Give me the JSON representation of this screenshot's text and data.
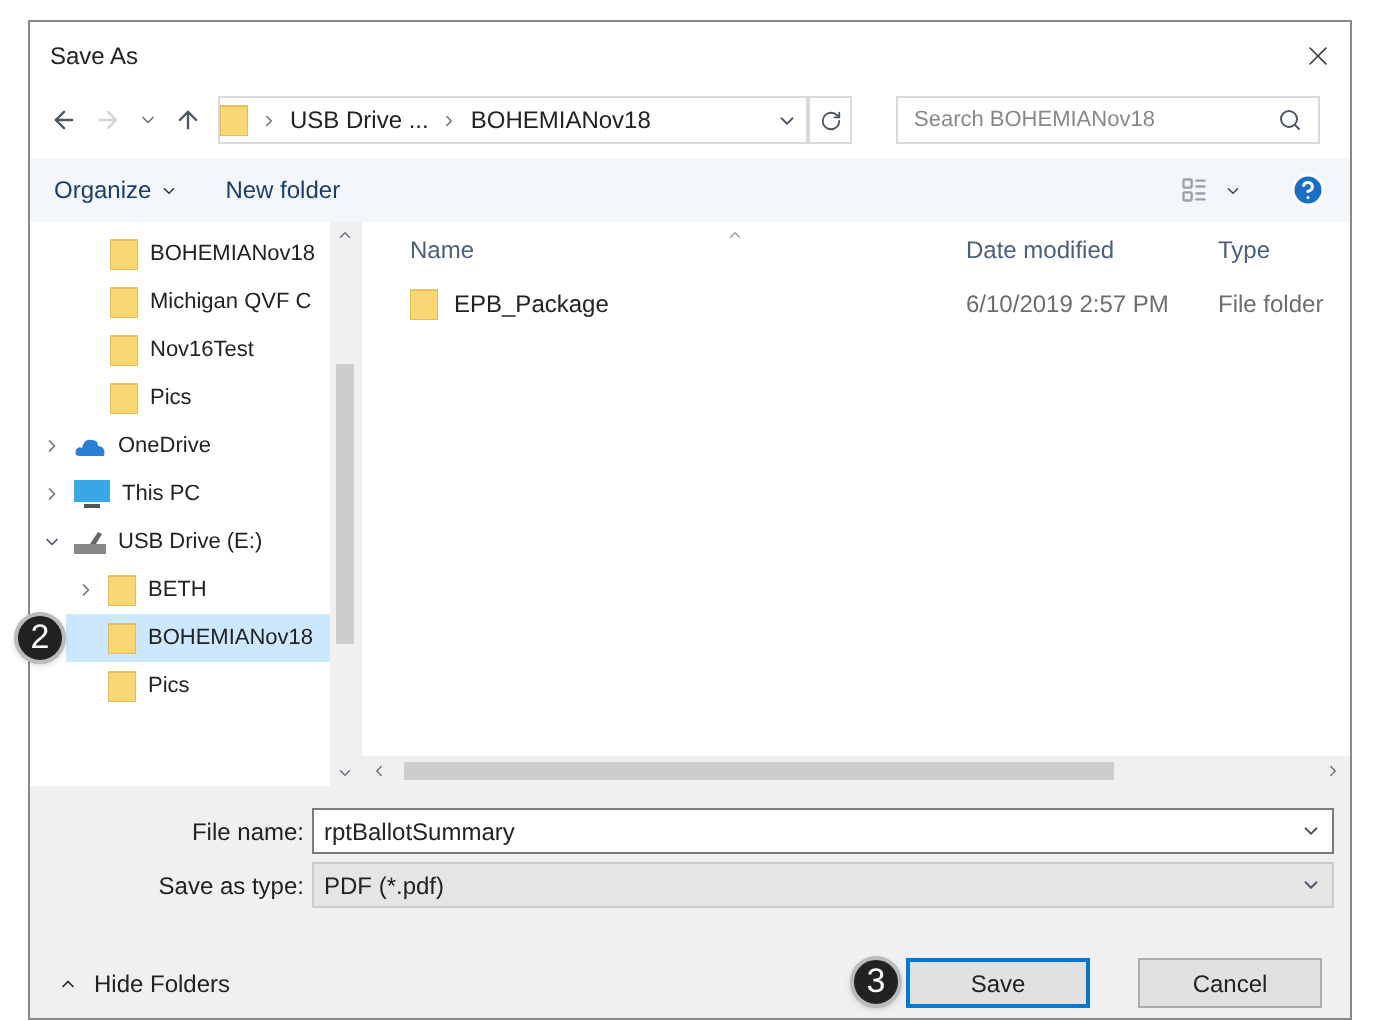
{
  "window": {
    "title": "Save As"
  },
  "address": {
    "crumbs": [
      "USB Drive ...",
      "BOHEMIANov18"
    ]
  },
  "search": {
    "placeholder": "Search BOHEMIANov18"
  },
  "toolbar": {
    "buttons": [
      "Organize",
      "New folder"
    ]
  },
  "nav": {
    "items": [
      {
        "label": "BOHEMIANov18",
        "kind": "subfolder",
        "selected": false
      },
      {
        "label": "Michigan QVF C",
        "kind": "subfolder",
        "selected": false
      },
      {
        "label": "Nov16Test",
        "kind": "subfolder",
        "selected": false
      },
      {
        "label": "Pics",
        "kind": "subfolder",
        "selected": false
      },
      {
        "label": "OneDrive",
        "kind": "cloud",
        "selected": false,
        "expanded": false
      },
      {
        "label": "This PC",
        "kind": "pc",
        "selected": false,
        "expanded": false
      },
      {
        "label": "USB Drive (E:)",
        "kind": "drive",
        "selected": false,
        "expanded": true,
        "children": [
          {
            "label": "BETH",
            "kind": "folder",
            "selected": false,
            "expanded": false
          },
          {
            "label": "BOHEMIANov18",
            "kind": "folder",
            "selected": true,
            "badge": "2"
          },
          {
            "label": "Pics",
            "kind": "folder",
            "selected": false
          }
        ]
      }
    ]
  },
  "table": {
    "columns": [
      "Name",
      "Date modified",
      "Type"
    ],
    "rows": [
      {
        "name": "EPB_Package",
        "date": "6/10/2019 2:57 PM",
        "type": "File folder",
        "selected": false
      }
    ]
  },
  "file_name": {
    "label": "File name:",
    "value": "rptBallotSummary"
  },
  "save_type": {
    "label": "Save as type:",
    "value": "PDF (*.pdf)"
  },
  "hide_folders": "Hide Folders",
  "buttons": [
    {
      "label": "Save",
      "default": true,
      "badge": "3"
    },
    {
      "label": "Cancel",
      "default": false
    }
  ]
}
